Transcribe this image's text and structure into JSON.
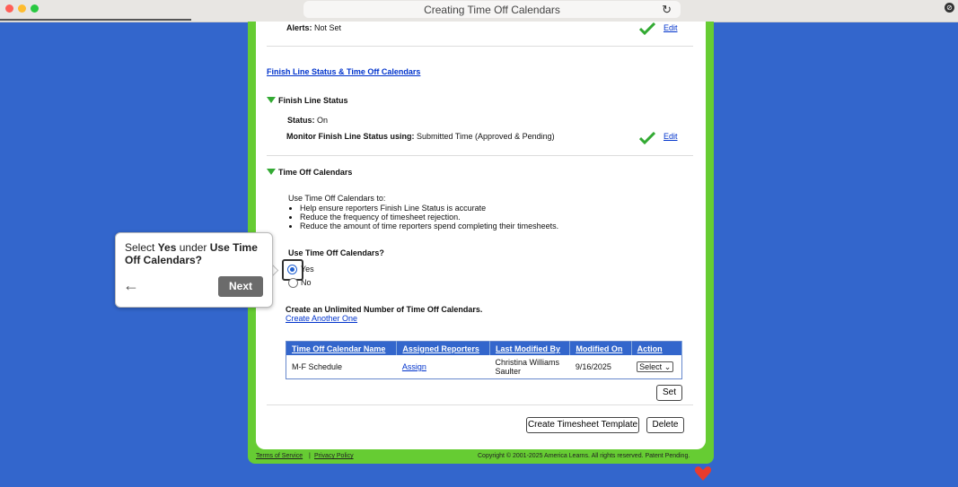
{
  "browser": {
    "title": "Creating Time Off Calendars"
  },
  "alerts": {
    "label": "Alerts:",
    "value": "Not Set",
    "edit": "Edit"
  },
  "section_link": "Finish Line Status & Time Off Calendars",
  "finish_line": {
    "heading": "Finish Line Status",
    "status_label": "Status:",
    "status_value": "On",
    "monitor_label": "Monitor Finish Line Status using:",
    "monitor_value": "Submitted Time (Approved & Pending)",
    "edit": "Edit"
  },
  "time_off": {
    "heading": "Time Off Calendars",
    "intro": "Use Time Off Calendars to:",
    "bullets": [
      "Help ensure reporters Finish Line Status is accurate",
      "Reduce the frequency of timesheet rejection.",
      "Reduce the amount of time reporters spend completing their timesheets."
    ],
    "question": "Use Time Off Calendars?",
    "opt_yes": "Yes",
    "opt_no": "No",
    "create_text": "Create an Unlimited Number of Time Off Calendars.",
    "create_link": "Create Another One"
  },
  "table": {
    "headers": [
      "Time Off Calendar Name",
      "Assigned Reporters",
      "Last Modified By",
      "Modified On",
      "Action"
    ],
    "row": {
      "name": "M-F Schedule",
      "assign": "Assign",
      "modified_by_1": "Christina Williams",
      "modified_by_2": "Saulter",
      "modified_on": "9/16/2025",
      "action": "Select"
    }
  },
  "buttons": {
    "set": "Set",
    "create_template": "Create Timesheet Template",
    "delete": "Delete"
  },
  "footer": {
    "tos": "Terms of Service",
    "privacy": "Privacy Policy",
    "copyright": "Copyright © 2001-2025 America Learns. All rights reserved. Patent Pending."
  },
  "tooltip": {
    "p1": "Select ",
    "b1": "Yes",
    "p2": " under ",
    "b2": "Use Time Off Calendars?",
    "next": "Next"
  },
  "colors": {
    "accent": "#3366cc",
    "frame": "#66cc33",
    "check": "#33aa33"
  }
}
